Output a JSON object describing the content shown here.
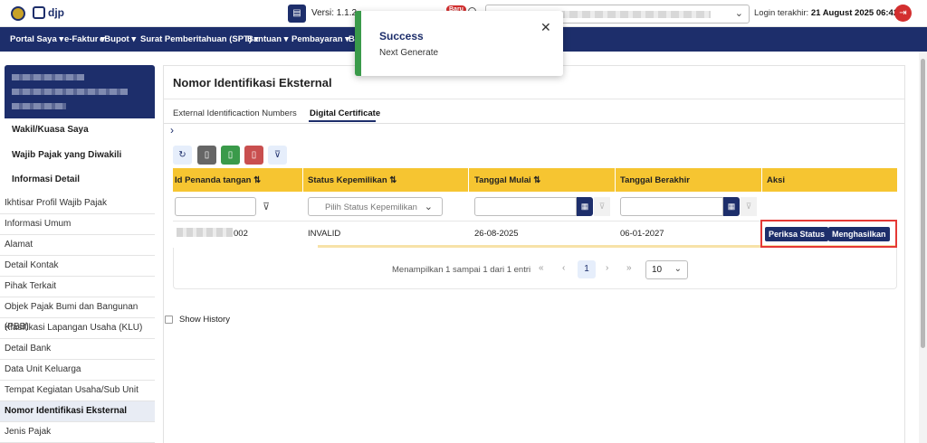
{
  "header": {
    "logo_text": "djp",
    "version_label": "Versi: 1.1.2-",
    "new_badge": "Baru",
    "last_login_label": "Login terakhir:",
    "last_login_value": "21 August 2025 06:42:24"
  },
  "nav": {
    "items": [
      "Portal Saya",
      "e-Faktur",
      "eBupot",
      "Surat Pemberitahuan (SPT)",
      "Bantuan",
      "Pembayaran",
      "B"
    ]
  },
  "toast": {
    "title": "Success",
    "message": "Next Generate",
    "close_icon": "close-icon"
  },
  "sidebar": {
    "sections": [
      "Wakil/Kuasa Saya",
      "Wajib Pajak yang Diwakili",
      "Informasi Detail"
    ],
    "items": [
      "Ikhtisar Profil Wajib Pajak",
      "Informasi Umum",
      "Alamat",
      "Detail Kontak",
      "Pihak Terkait",
      "Objek Pajak Bumi dan Bangunan (PBB)",
      "Klasifikasi Lapangan Usaha (KLU)",
      "Detail Bank",
      "Data Unit Keluarga",
      "Tempat Kegiatan Usaha/Sub Unit",
      "Nomor Identifikasi Eksternal",
      "Jenis Pajak"
    ],
    "active_item": "Nomor Identifikasi Eksternal"
  },
  "main": {
    "title": "Nomor Identifikasi Eksternal",
    "tabs": [
      {
        "label": "External Identificaction Numbers",
        "active": false
      },
      {
        "label": "Digital Certificate",
        "active": true
      }
    ],
    "toolbar_icons": [
      "refresh-icon",
      "file-icon",
      "excel-icon",
      "pdf-icon",
      "clear-filter-icon"
    ],
    "table": {
      "columns": [
        {
          "label": "Id Penanda tangan",
          "sort": "⇅"
        },
        {
          "label": "Status Kepemilikan",
          "sort": "⇅"
        },
        {
          "label": "Tanggal Mulai",
          "sort": "⇅"
        },
        {
          "label": "Tanggal Berakhir",
          "sort": ""
        },
        {
          "label": "Aksi",
          "sort": ""
        }
      ],
      "filter_placeholder_status": "Pilih Status Kepemilikan",
      "rows": [
        {
          "id_suffix": "002",
          "status": "INVALID",
          "start_date": "26-08-2025",
          "end_date": "06-01-2027",
          "actions": [
            "Periksa Status",
            "Menghasilkan"
          ]
        }
      ]
    },
    "pagination": {
      "summary": "Menampilkan 1 sampai 1 dari 1 entri",
      "first": "«",
      "prev": "‹",
      "page": "1",
      "next": "›",
      "last": "»",
      "page_size": "10"
    },
    "show_history_label": "Show History"
  },
  "colors": {
    "brand": "#1d2e6b",
    "table_header": "#f6c531",
    "success": "#3a9a4a",
    "danger": "#d32f2f"
  }
}
